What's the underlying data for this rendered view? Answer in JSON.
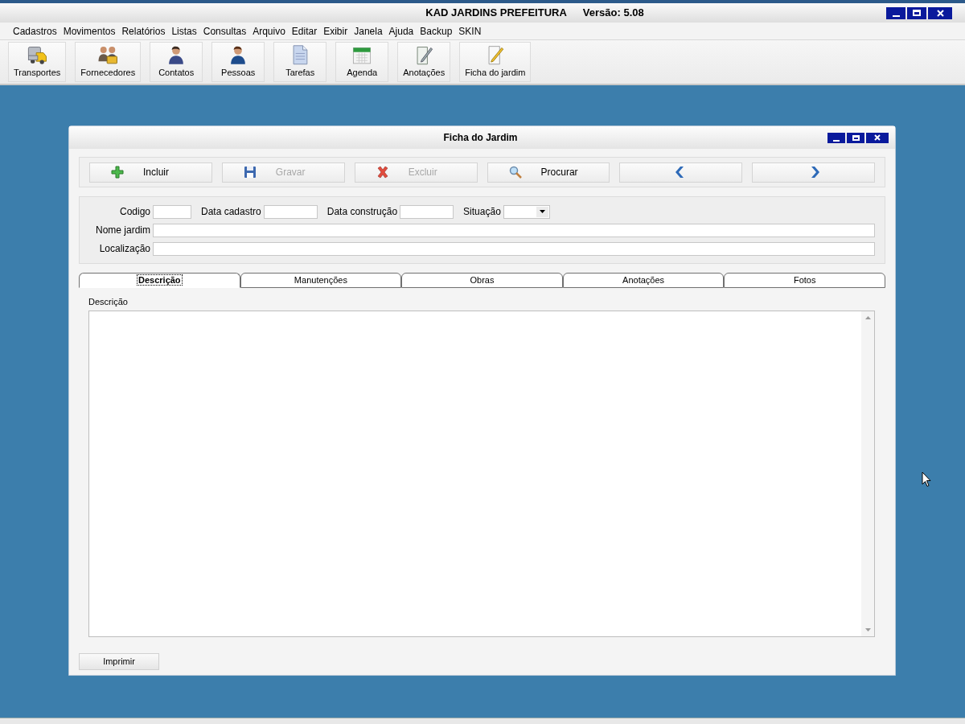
{
  "window": {
    "title": "KAD JARDINS PREFEITURA",
    "version": "Versão: 5.08"
  },
  "menu": [
    "Cadastros",
    "Movimentos",
    "Relatórios",
    "Listas",
    "Consultas",
    "Arquivo",
    "Editar",
    "Exibir",
    "Janela",
    "Ajuda",
    "Backup",
    "SKIN"
  ],
  "toolbar": [
    {
      "label": "Transportes",
      "kind": "truck"
    },
    {
      "label": "Fornecedores",
      "kind": "people"
    },
    {
      "label": "Contatos",
      "kind": "person"
    },
    {
      "label": "Pessoas",
      "kind": "person-blue"
    },
    {
      "label": "Tarefas",
      "kind": "document"
    },
    {
      "label": "Agenda",
      "kind": "calendar"
    },
    {
      "label": "Anotações",
      "kind": "notepad"
    },
    {
      "label": "Ficha do jardim",
      "kind": "pencil"
    }
  ],
  "form_window": {
    "title": "Ficha do Jardim",
    "actions": [
      {
        "label": "Incluir",
        "kind": "plus",
        "disabled": false
      },
      {
        "label": "Gravar",
        "kind": "disk",
        "disabled": true
      },
      {
        "label": "Excluir",
        "kind": "x",
        "disabled": true
      },
      {
        "label": "Procurar",
        "kind": "magnifier",
        "disabled": false
      },
      {
        "kind": "prev",
        "disabled": false
      },
      {
        "kind": "next",
        "disabled": false
      }
    ],
    "field_rows": [
      [
        {
          "label": "Codigo",
          "kind": "text"
        },
        {
          "label": "Data cadastro",
          "kind": "text"
        },
        {
          "label": "Data construção",
          "kind": "text"
        },
        {
          "label": "Situação",
          "kind": "select"
        }
      ],
      [
        {
          "label": "Nome jardim",
          "kind": "wide"
        }
      ],
      [
        {
          "label": "Localização",
          "kind": "wide"
        }
      ]
    ],
    "tabs": [
      {
        "label": "Descrição",
        "selected": true
      },
      {
        "label": "Manutenções",
        "selected": false
      },
      {
        "label": "Obras",
        "selected": false
      },
      {
        "label": "Anotações",
        "selected": false
      },
      {
        "label": "Fotos",
        "selected": false
      }
    ],
    "description_label": "Descrição",
    "print_button": "Imprimir"
  }
}
